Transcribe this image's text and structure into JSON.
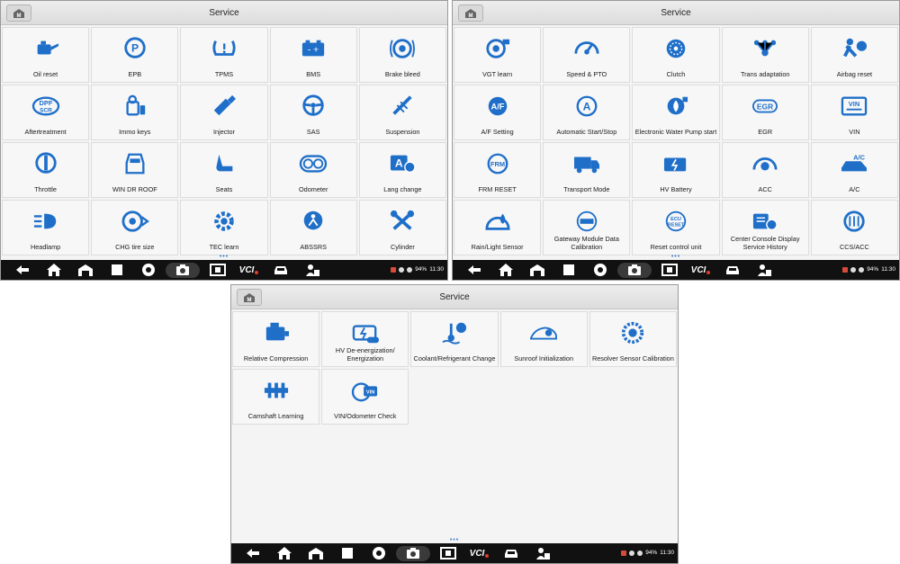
{
  "screens": [
    {
      "title": "Service",
      "page_indicator": "•••",
      "tiles": [
        {
          "label": "Oil reset",
          "icon": "oil-can-icon"
        },
        {
          "label": "EPB",
          "icon": "parking-brake-icon"
        },
        {
          "label": "TPMS",
          "icon": "tire-pressure-icon"
        },
        {
          "label": "BMS",
          "icon": "battery-icon"
        },
        {
          "label": "Brake bleed",
          "icon": "brake-disc-icon"
        },
        {
          "label": "Aftertreatment",
          "icon": "dpf-scr-icon"
        },
        {
          "label": "Immo keys",
          "icon": "key-immobilizer-icon"
        },
        {
          "label": "Injector",
          "icon": "injector-icon"
        },
        {
          "label": "SAS",
          "icon": "steering-wheel-icon"
        },
        {
          "label": "Suspension",
          "icon": "suspension-icon"
        },
        {
          "label": "Throttle",
          "icon": "throttle-icon"
        },
        {
          "label": "WIN DR ROOF",
          "icon": "car-top-icon"
        },
        {
          "label": "Seats",
          "icon": "seat-icon"
        },
        {
          "label": "Odometer",
          "icon": "odometer-icon"
        },
        {
          "label": "Lang change",
          "icon": "language-icon"
        },
        {
          "label": "Headlamp",
          "icon": "headlamp-icon"
        },
        {
          "label": "CHG tire size",
          "icon": "tire-size-icon"
        },
        {
          "label": "TEC learn",
          "icon": "gear-learn-icon"
        },
        {
          "label": "ABSSRS",
          "icon": "abs-srs-icon"
        },
        {
          "label": "Cylinder",
          "icon": "piston-icon"
        }
      ],
      "status": {
        "battery": "94%",
        "time": "11:30"
      }
    },
    {
      "title": "Service",
      "page_indicator": "•••",
      "tiles": [
        {
          "label": "VGT learn",
          "icon": "turbo-icon"
        },
        {
          "label": "Speed & PTO",
          "icon": "speedometer-icon"
        },
        {
          "label": "Clutch",
          "icon": "clutch-icon"
        },
        {
          "label": "Trans adaptation",
          "icon": "transmission-icon"
        },
        {
          "label": "Airbag reset",
          "icon": "airbag-icon"
        },
        {
          "label": "A/F Setting",
          "icon": "af-setting-icon"
        },
        {
          "label": "Automatic Start/Stop",
          "icon": "auto-start-stop-icon"
        },
        {
          "label": "Electronic Water Pump start",
          "icon": "water-pump-icon"
        },
        {
          "label": "EGR",
          "icon": "egr-icon"
        },
        {
          "label": "VIN",
          "icon": "vin-icon"
        },
        {
          "label": "FRM RESET",
          "icon": "frm-reset-icon"
        },
        {
          "label": "Transport Mode",
          "icon": "truck-icon"
        },
        {
          "label": "HV Battery",
          "icon": "hv-battery-icon"
        },
        {
          "label": "ACC",
          "icon": "acc-icon"
        },
        {
          "label": "A/C",
          "icon": "air-conditioning-icon"
        },
        {
          "label": "Rain/Light Sensor",
          "icon": "rain-light-sensor-icon"
        },
        {
          "label": "Gateway Module Data Calibration",
          "icon": "gateway-module-icon"
        },
        {
          "label": "Reset control unit",
          "icon": "ecu-reset-icon"
        },
        {
          "label": "Center Console Display Service History",
          "icon": "console-history-icon"
        },
        {
          "label": "CCS/ACC",
          "icon": "ccs-acc-icon"
        }
      ],
      "status": {
        "battery": "94%",
        "time": "11:30"
      }
    },
    {
      "title": "Service",
      "page_indicator": "•••",
      "tiles": [
        {
          "label": "Relative Compression",
          "icon": "engine-compression-icon"
        },
        {
          "label": "HV De-energization/ Energization",
          "icon": "hv-on-off-icon"
        },
        {
          "label": "Coolant/Refrigerant Change",
          "icon": "coolant-icon"
        },
        {
          "label": "Sunroof Initialization",
          "icon": "sunroof-car-icon"
        },
        {
          "label": "Resolver Sensor Calibration",
          "icon": "resolver-sensor-icon"
        },
        {
          "label": "Camshaft Learning",
          "icon": "camshaft-icon"
        },
        {
          "label": "VIN/Odometer Check",
          "icon": "vin-odometer-icon"
        }
      ],
      "status": {
        "battery": "94%",
        "time": "11:30"
      }
    }
  ],
  "navbar": {
    "vci_label": "VCI",
    "buttons": [
      "back-icon",
      "home-icon",
      "garage-icon",
      "recent-apps-icon",
      "browser-icon",
      "camera-icon",
      "screenshot-icon",
      "vci-icon",
      "car-icon",
      "technician-icon"
    ]
  },
  "colors": {
    "icon_blue": "#1f6fc9",
    "navbar": "#111111",
    "tile_bg": "#f7f7f7"
  }
}
